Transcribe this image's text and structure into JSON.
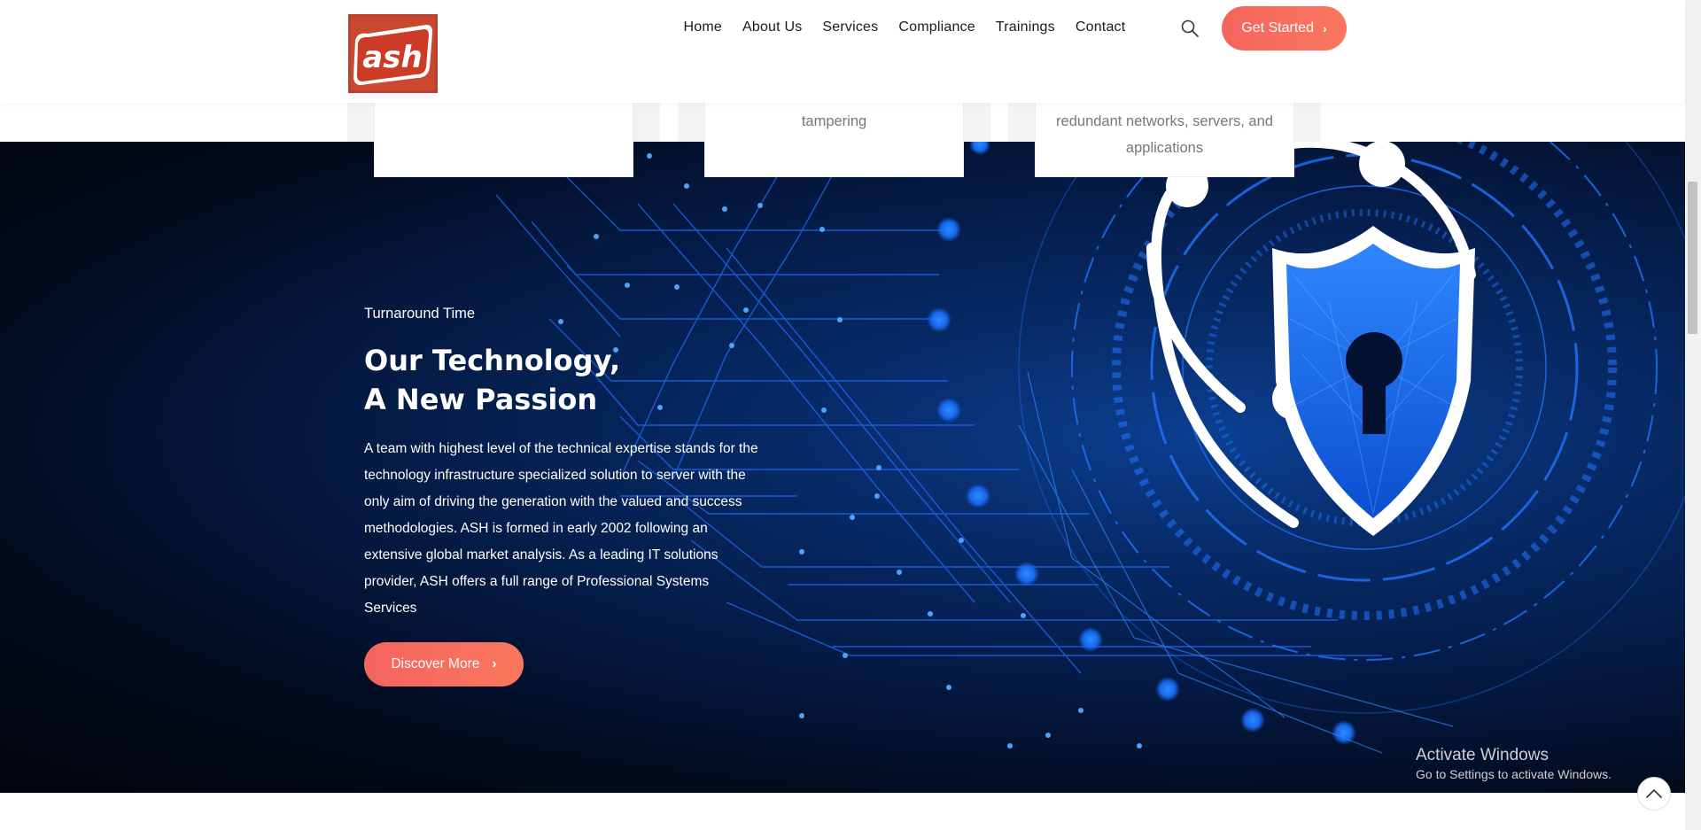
{
  "header": {
    "logo_text": "ash",
    "nav": [
      "Home",
      "About Us",
      "Services",
      "Compliance",
      "Trainings",
      "Contact"
    ],
    "cta_label": "Get Started"
  },
  "cards": [
    {
      "text": ""
    },
    {
      "text": "tampering"
    },
    {
      "text": "redundant networks, servers, and applications"
    }
  ],
  "hero": {
    "eyebrow": "Turnaround Time",
    "title_line1": "Our Technology,",
    "title_line2": "A New Passion",
    "paragraph": "A team with highest level of the technical expertise stands for the technology infrastructure specialized solution to server with the only aim of driving the generation with the valued and success methodologies. ASH is formed in early 2002 following an extensive global market analysis. As a leading IT solutions provider, ASH offers a full range of Professional Systems Services",
    "button_label": "Discover More"
  },
  "watermark": {
    "line1": "Activate Windows",
    "line2": "Go to Settings to activate Windows."
  },
  "colors": {
    "accent": "#f66a5e",
    "hero_dark": "#020a1c",
    "hero_blue": "#0b3f91",
    "glow_blue": "#1a7cff"
  }
}
